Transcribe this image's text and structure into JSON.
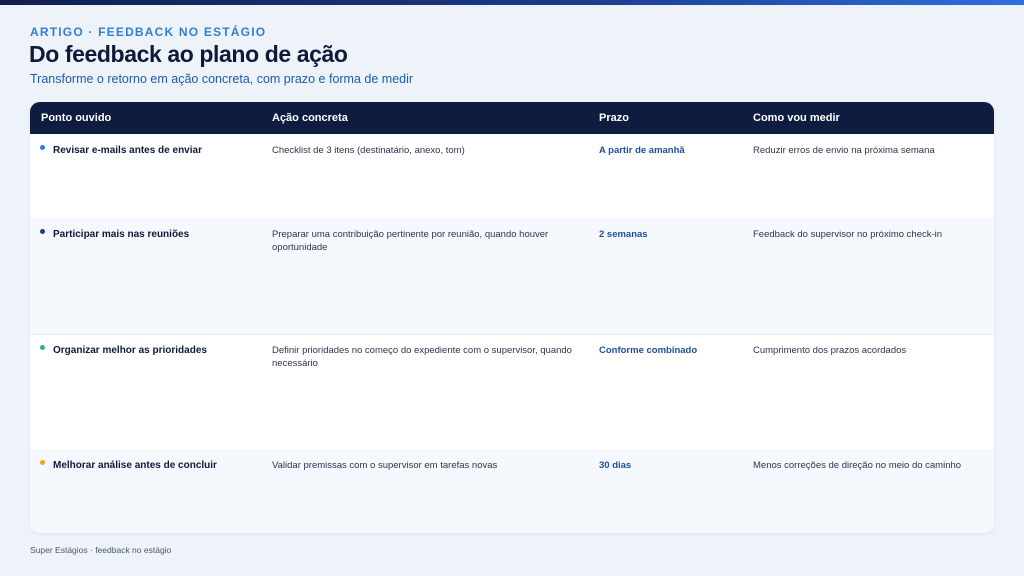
{
  "header": {
    "eyebrow": "ARTIGO · FEEDBACK NO ESTÁGIO",
    "title": "Do feedback ao plano de ação",
    "subtitle": "Transforme o retorno em ação concreta, com prazo e forma de medir"
  },
  "table": {
    "columns": [
      "Ponto ouvido",
      "Ação concreta",
      "Prazo",
      "Como vou medir"
    ],
    "rows": [
      {
        "point": "Revisar e-mails antes de enviar",
        "action": "Checklist de 3 itens (destinatário, anexo, tom)",
        "deadline": "A partir de amanhã",
        "measure": "Reduzir erros de envio na próxima semana",
        "dot_color": "#2f7fd8"
      },
      {
        "point": "Participar mais nas reuniões",
        "action": "Preparar uma contribuição pertinente por reunião, quando houver oportunidade",
        "deadline": "2 semanas",
        "measure": "Feedback do supervisor no próximo check-in",
        "dot_color": "#1d3f8a"
      },
      {
        "point": "Organizar melhor as prioridades",
        "action": "Definir prioridades no começo do expediente com o supervisor, quando necessário",
        "deadline": "Conforme combinado",
        "measure": "Cumprimento dos prazos acordados",
        "dot_color": "#2fb86a"
      },
      {
        "point": "Melhorar análise antes de concluir",
        "action": "Validar premissas com o supervisor em tarefas novas",
        "deadline": "30 dias",
        "measure": "Menos correções de direção no meio do caminho",
        "dot_color": "#f0a030"
      }
    ]
  },
  "footer": {
    "text": "Super Estágios · feedback no estágio"
  }
}
